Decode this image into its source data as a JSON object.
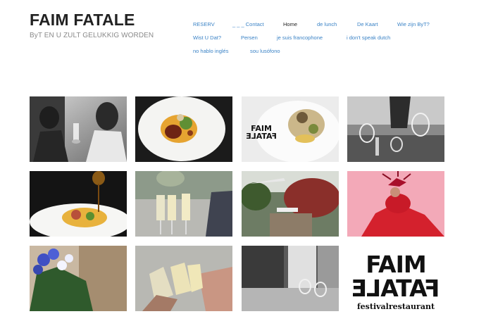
{
  "site": {
    "title": "FAIM FATALE",
    "tagline": "ByT EN U ZULT GELUKKIG WORDEN"
  },
  "nav": [
    {
      "label": "RESERV"
    },
    {
      "label": "_ _ _ Contact"
    },
    {
      "label": "Home",
      "current": true
    },
    {
      "label": "de lunch"
    },
    {
      "label": "De Kaart"
    },
    {
      "label": "Wie zijn ByT?"
    },
    {
      "label": "Wist U Dat?"
    },
    {
      "label": "Persen"
    },
    {
      "label": "je suis francophone"
    },
    {
      "label": "i don't speak dutch"
    },
    {
      "label": "no hablo inglés"
    },
    {
      "label": "sou lusófono"
    }
  ],
  "gallery": {
    "logo": {
      "word1": "FAIM",
      "word2": "FATALE",
      "sub": "festivalrestaurant"
    }
  },
  "colors": {
    "link": "#3b83c6",
    "title": "#222222",
    "tagline": "#8a8a8a"
  }
}
